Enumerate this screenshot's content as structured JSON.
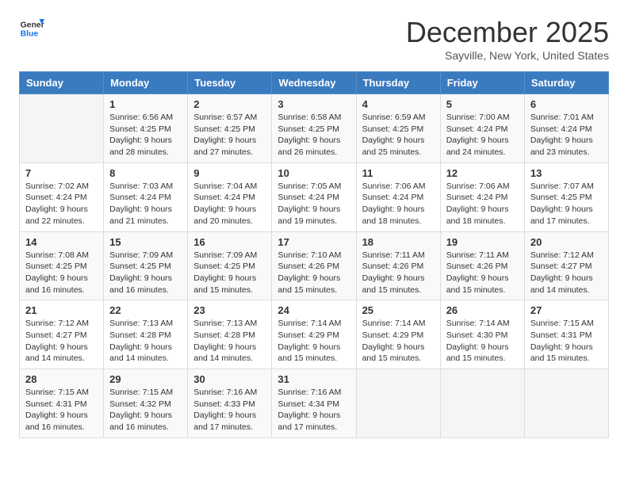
{
  "logo": {
    "line1": "General",
    "line2": "Blue"
  },
  "title": "December 2025",
  "location": "Sayville, New York, United States",
  "days_header": [
    "Sunday",
    "Monday",
    "Tuesday",
    "Wednesday",
    "Thursday",
    "Friday",
    "Saturday"
  ],
  "weeks": [
    [
      {
        "day": "",
        "info": ""
      },
      {
        "day": "1",
        "info": "Sunrise: 6:56 AM\nSunset: 4:25 PM\nDaylight: 9 hours\nand 28 minutes."
      },
      {
        "day": "2",
        "info": "Sunrise: 6:57 AM\nSunset: 4:25 PM\nDaylight: 9 hours\nand 27 minutes."
      },
      {
        "day": "3",
        "info": "Sunrise: 6:58 AM\nSunset: 4:25 PM\nDaylight: 9 hours\nand 26 minutes."
      },
      {
        "day": "4",
        "info": "Sunrise: 6:59 AM\nSunset: 4:25 PM\nDaylight: 9 hours\nand 25 minutes."
      },
      {
        "day": "5",
        "info": "Sunrise: 7:00 AM\nSunset: 4:24 PM\nDaylight: 9 hours\nand 24 minutes."
      },
      {
        "day": "6",
        "info": "Sunrise: 7:01 AM\nSunset: 4:24 PM\nDaylight: 9 hours\nand 23 minutes."
      }
    ],
    [
      {
        "day": "7",
        "info": "Sunrise: 7:02 AM\nSunset: 4:24 PM\nDaylight: 9 hours\nand 22 minutes."
      },
      {
        "day": "8",
        "info": "Sunrise: 7:03 AM\nSunset: 4:24 PM\nDaylight: 9 hours\nand 21 minutes."
      },
      {
        "day": "9",
        "info": "Sunrise: 7:04 AM\nSunset: 4:24 PM\nDaylight: 9 hours\nand 20 minutes."
      },
      {
        "day": "10",
        "info": "Sunrise: 7:05 AM\nSunset: 4:24 PM\nDaylight: 9 hours\nand 19 minutes."
      },
      {
        "day": "11",
        "info": "Sunrise: 7:06 AM\nSunset: 4:24 PM\nDaylight: 9 hours\nand 18 minutes."
      },
      {
        "day": "12",
        "info": "Sunrise: 7:06 AM\nSunset: 4:24 PM\nDaylight: 9 hours\nand 18 minutes."
      },
      {
        "day": "13",
        "info": "Sunrise: 7:07 AM\nSunset: 4:25 PM\nDaylight: 9 hours\nand 17 minutes."
      }
    ],
    [
      {
        "day": "14",
        "info": "Sunrise: 7:08 AM\nSunset: 4:25 PM\nDaylight: 9 hours\nand 16 minutes."
      },
      {
        "day": "15",
        "info": "Sunrise: 7:09 AM\nSunset: 4:25 PM\nDaylight: 9 hours\nand 16 minutes."
      },
      {
        "day": "16",
        "info": "Sunrise: 7:09 AM\nSunset: 4:25 PM\nDaylight: 9 hours\nand 15 minutes."
      },
      {
        "day": "17",
        "info": "Sunrise: 7:10 AM\nSunset: 4:26 PM\nDaylight: 9 hours\nand 15 minutes."
      },
      {
        "day": "18",
        "info": "Sunrise: 7:11 AM\nSunset: 4:26 PM\nDaylight: 9 hours\nand 15 minutes."
      },
      {
        "day": "19",
        "info": "Sunrise: 7:11 AM\nSunset: 4:26 PM\nDaylight: 9 hours\nand 15 minutes."
      },
      {
        "day": "20",
        "info": "Sunrise: 7:12 AM\nSunset: 4:27 PM\nDaylight: 9 hours\nand 14 minutes."
      }
    ],
    [
      {
        "day": "21",
        "info": "Sunrise: 7:12 AM\nSunset: 4:27 PM\nDaylight: 9 hours\nand 14 minutes."
      },
      {
        "day": "22",
        "info": "Sunrise: 7:13 AM\nSunset: 4:28 PM\nDaylight: 9 hours\nand 14 minutes."
      },
      {
        "day": "23",
        "info": "Sunrise: 7:13 AM\nSunset: 4:28 PM\nDaylight: 9 hours\nand 14 minutes."
      },
      {
        "day": "24",
        "info": "Sunrise: 7:14 AM\nSunset: 4:29 PM\nDaylight: 9 hours\nand 15 minutes."
      },
      {
        "day": "25",
        "info": "Sunrise: 7:14 AM\nSunset: 4:29 PM\nDaylight: 9 hours\nand 15 minutes."
      },
      {
        "day": "26",
        "info": "Sunrise: 7:14 AM\nSunset: 4:30 PM\nDaylight: 9 hours\nand 15 minutes."
      },
      {
        "day": "27",
        "info": "Sunrise: 7:15 AM\nSunset: 4:31 PM\nDaylight: 9 hours\nand 15 minutes."
      }
    ],
    [
      {
        "day": "28",
        "info": "Sunrise: 7:15 AM\nSunset: 4:31 PM\nDaylight: 9 hours\nand 16 minutes."
      },
      {
        "day": "29",
        "info": "Sunrise: 7:15 AM\nSunset: 4:32 PM\nDaylight: 9 hours\nand 16 minutes."
      },
      {
        "day": "30",
        "info": "Sunrise: 7:16 AM\nSunset: 4:33 PM\nDaylight: 9 hours\nand 17 minutes."
      },
      {
        "day": "31",
        "info": "Sunrise: 7:16 AM\nSunset: 4:34 PM\nDaylight: 9 hours\nand 17 minutes."
      },
      {
        "day": "",
        "info": ""
      },
      {
        "day": "",
        "info": ""
      },
      {
        "day": "",
        "info": ""
      }
    ]
  ]
}
